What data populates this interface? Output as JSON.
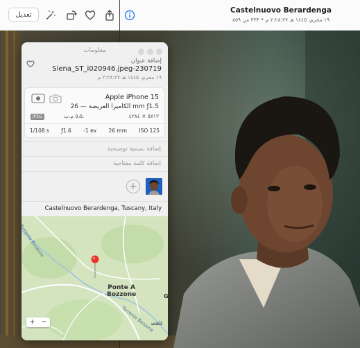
{
  "toolbar": {
    "edit_label": "تعديل",
    "title": "Castelnuovo Berardenga",
    "subtitle": "١٩ محرم، ١٤٤٥ هـ ٢:٢٨:٢٧ م • ٣٣٣ من ٨٥٩",
    "icons": [
      "magic-wand-icon",
      "rotate-icon",
      "heart-icon",
      "share-icon",
      "info-icon"
    ],
    "accent_color": "#1a73e8"
  },
  "info_panel": {
    "title": "معلومات",
    "add_title": "إضافة عنوان",
    "filename": "Siena_ST_i020946.jpeg-230719",
    "date_line": "١٩ محرم، ١٤٤٥ هـ ٢:٢٨:٢٧ م",
    "camera": {
      "device": "Apple iPhone 15",
      "lens": "الكاميرا العريضة — 26 mm ƒ1.5",
      "format_badge": "JPEG",
      "megapixels": "٥٫٥ م.ب.",
      "dimensions": "٥٧١٢ × ٤٢٨٤",
      "exif": [
        "1/108 s",
        "ƒ1.6",
        "-1 ev",
        "26 mm",
        "ISO 125"
      ]
    },
    "caption_placeholder": "إضافة تسمية توضيحية",
    "keyword_placeholder": "إضافة كلمة مفتاحية",
    "add_person": "+",
    "location": "Castelnuovo Berardenga, Tuscany, Italy",
    "map": {
      "town": [
        "Ponte A",
        "Bozzone"
      ],
      "road_label_1": "Torrente Bozzone",
      "road_label_2": "Torrente Bozzone",
      "edge_label": "G",
      "zoom_in": "+",
      "zoom_out": "−",
      "legal": "قانوني"
    }
  }
}
